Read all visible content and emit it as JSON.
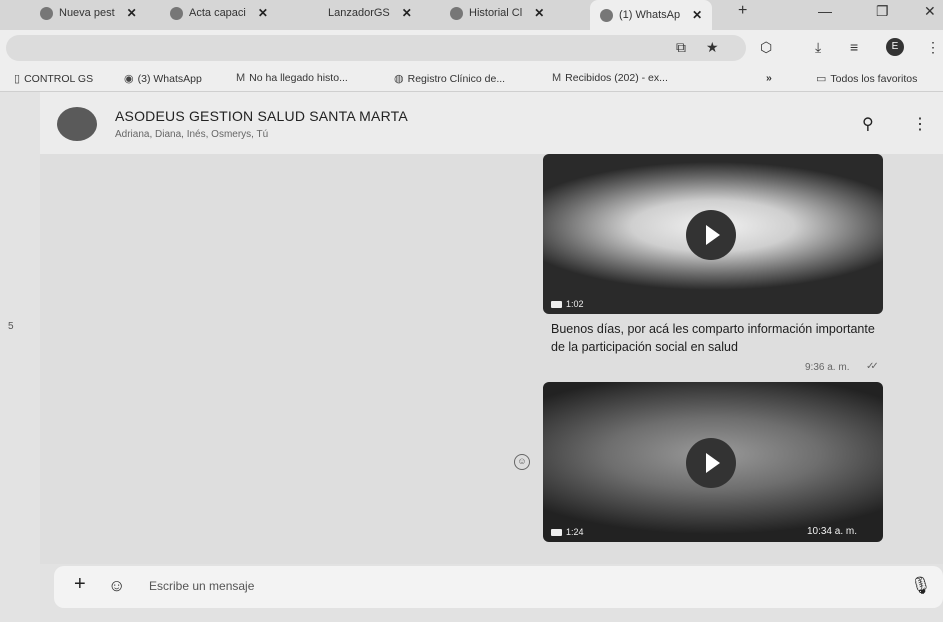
{
  "browser": {
    "tabs": [
      {
        "label": "Nueva pest"
      },
      {
        "label": "Acta capaci"
      },
      {
        "label": "LanzadorGS"
      },
      {
        "label": "Historial Cl"
      },
      {
        "label": "(1) WhatsAp"
      }
    ],
    "new_tab": "+",
    "bookmarks": [
      {
        "label": "CONTROL GS"
      },
      {
        "label": "(3) WhatsApp"
      },
      {
        "label": "No ha llegado histo..."
      },
      {
        "label": "Registro Clínico de..."
      },
      {
        "label": "Recibidos (202) - ex..."
      }
    ],
    "more_bookmarks": "»",
    "all_favorites": "Todos los favoritos",
    "profile_initial": "E"
  },
  "side": {
    "number": "5"
  },
  "chat": {
    "group_name": "ASODEUS GESTION SALUD SANTA MARTA",
    "members": "Adriana, Diana, Inés, Osmerys, Tú",
    "messages": [
      {
        "type": "video",
        "duration": "1:02",
        "caption": "Buenos días, por acá les comparto información importante de la participación social en salud",
        "time": "9:36 a. m."
      },
      {
        "type": "video",
        "duration": "1:24",
        "time": "10:34 a. m."
      }
    ]
  },
  "composer": {
    "placeholder": "Escribe un mensaje"
  }
}
